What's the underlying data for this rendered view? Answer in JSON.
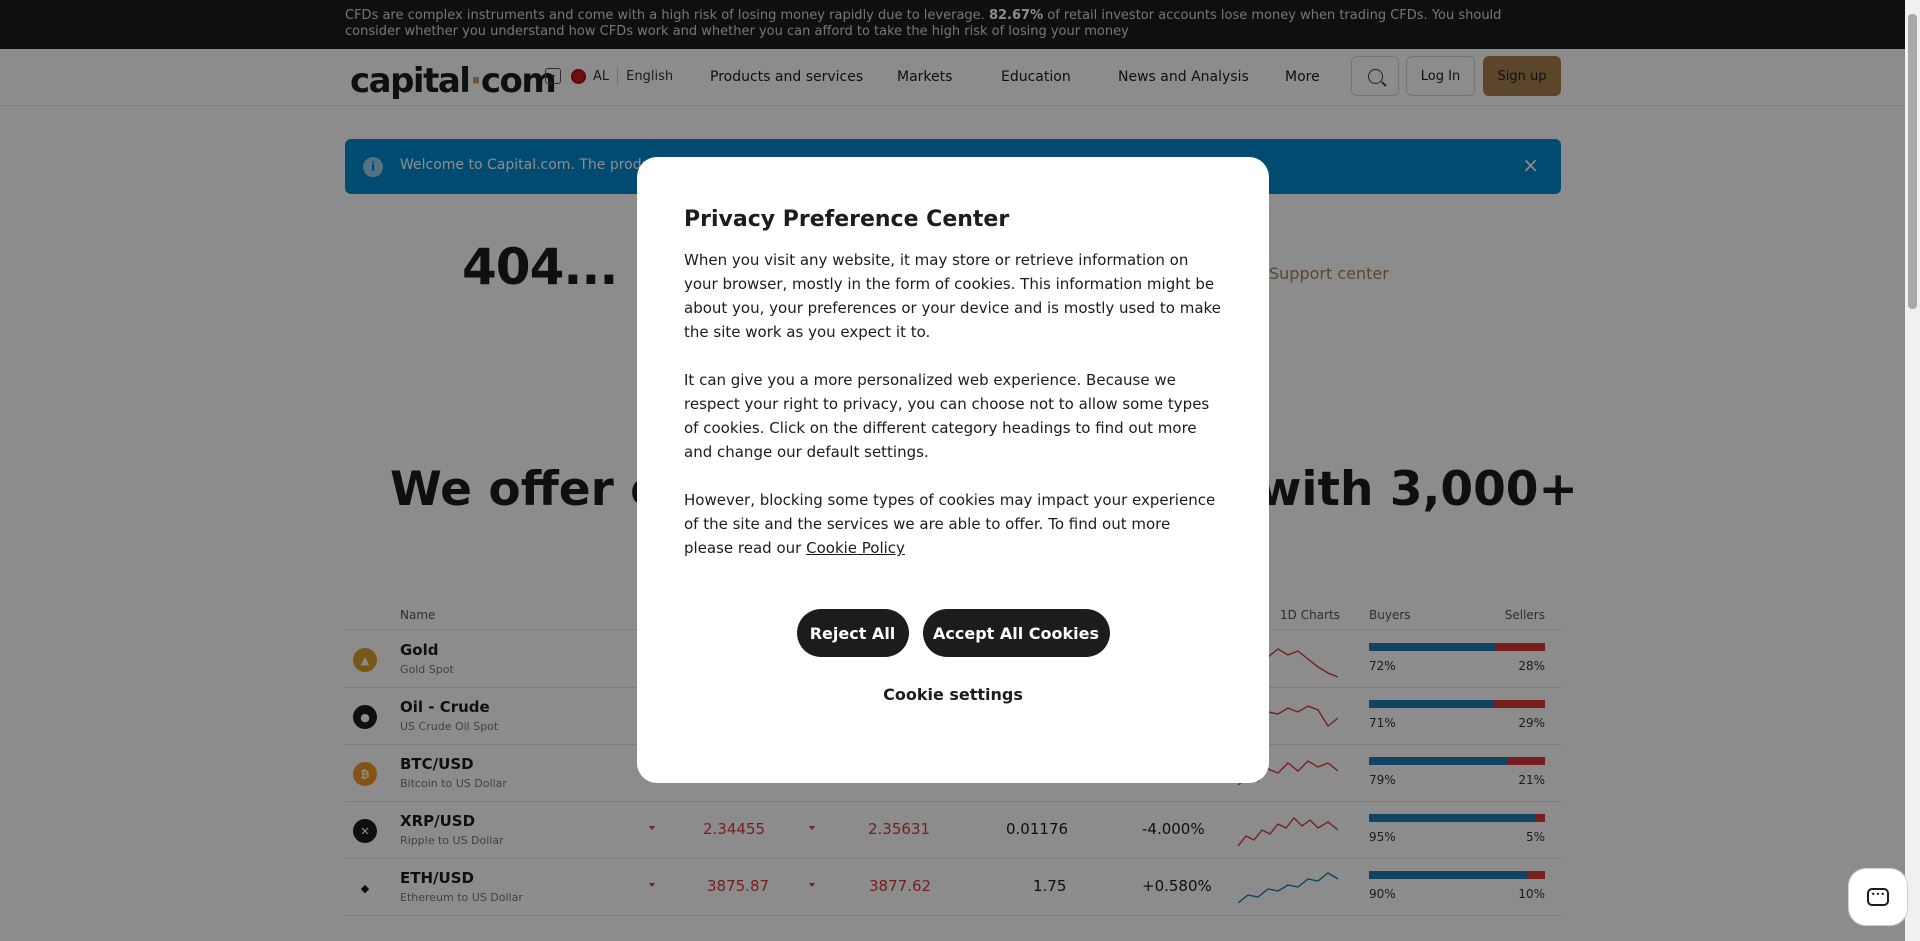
{
  "risk_banner": {
    "text_before": "CFDs are complex instruments and come with a high risk of losing money rapidly due to leverage.",
    "percent": "82.67%",
    "text_after": "of retail investor accounts lose money when trading CFDs. You should consider whether you understand how CFDs work and whether you can afford to take the high risk of losing your money"
  },
  "header": {
    "logo_name": "capital",
    "logo_dot": "·",
    "logo_tld": "com",
    "region": "AL",
    "language": "English",
    "nav": [
      "Products and services",
      "Markets",
      "Education",
      "News and Analysis",
      "More"
    ],
    "login_label": "Log In",
    "signup_label": "Sign up"
  },
  "welcome": {
    "text": "Welcome to Capital.com. The products a",
    "close": "×"
  },
  "error": {
    "code": "404...",
    "support_link": "Support center"
  },
  "offer": {
    "title_left": "We offer or",
    "title_right": "with 3,000+"
  },
  "markets": {
    "columns": {
      "name": "Name",
      "charts": "1D Charts",
      "buyers": "Buyers",
      "sellers": "Sellers"
    },
    "rows": [
      {
        "name": "Gold",
        "sub": "Gold Spot",
        "icon": "gold-icon",
        "sell": "",
        "buy": "",
        "change": "",
        "pct": "",
        "buyers": "72%",
        "sellers": "28%",
        "buyers_share": 0.72
      },
      {
        "name": "Oil - Crude",
        "sub": "US Crude Oil Spot",
        "icon": "oil-icon",
        "sell": "",
        "buy": "",
        "change": "",
        "pct": "",
        "buyers": "71%",
        "sellers": "29%",
        "buyers_share": 0.71
      },
      {
        "name": "BTC/USD",
        "sub": "Bitcoin to US Dollar",
        "icon": "bitcoin-icon",
        "sell": "",
        "buy": "",
        "change": "",
        "pct": "",
        "buyers": "79%",
        "sellers": "21%",
        "buyers_share": 0.79
      },
      {
        "name": "XRP/USD",
        "sub": "Ripple to US Dollar",
        "icon": "ripple-icon",
        "sell": "2.34455",
        "buy": "2.35631",
        "change": "0.01176",
        "pct": "-4.000%",
        "buyers": "95%",
        "sellers": "5%",
        "buyers_share": 0.95
      },
      {
        "name": "ETH/USD",
        "sub": "Ethereum to US Dollar",
        "icon": "ethereum-icon",
        "sell": "3875.87",
        "buy": "3877.62",
        "change": "1.75",
        "pct": "+0.580%",
        "buyers": "90%",
        "sellers": "10%",
        "buyers_share": 0.9
      }
    ]
  },
  "modal": {
    "title": "Privacy Preference Center",
    "p1": "When you visit any website, it may store or retrieve information on your browser, mostly in the form of cookies. This information might be about you, your preferences or your device and is mostly used to make the site work as you expect it to.",
    "p2": "It can give you a more personalized web experience. Because we respect your right to privacy, you can choose not to allow some types of cookies. Click on the different category headings to find out more and change our default settings.",
    "p3": "However, blocking some types of cookies may impact your experience of the site and the services we are able to offer. To find out more please read our",
    "policy_link": "Cookie Policy",
    "reject_label": "Reject All",
    "accept_label": "Accept All Cookies",
    "settings_label": "Cookie settings"
  },
  "colors": {
    "accent": "#a7804f",
    "info_blue": "#0089d0",
    "buyers_blue": "#1f7bb3",
    "sellers_red": "#d53a3a"
  }
}
